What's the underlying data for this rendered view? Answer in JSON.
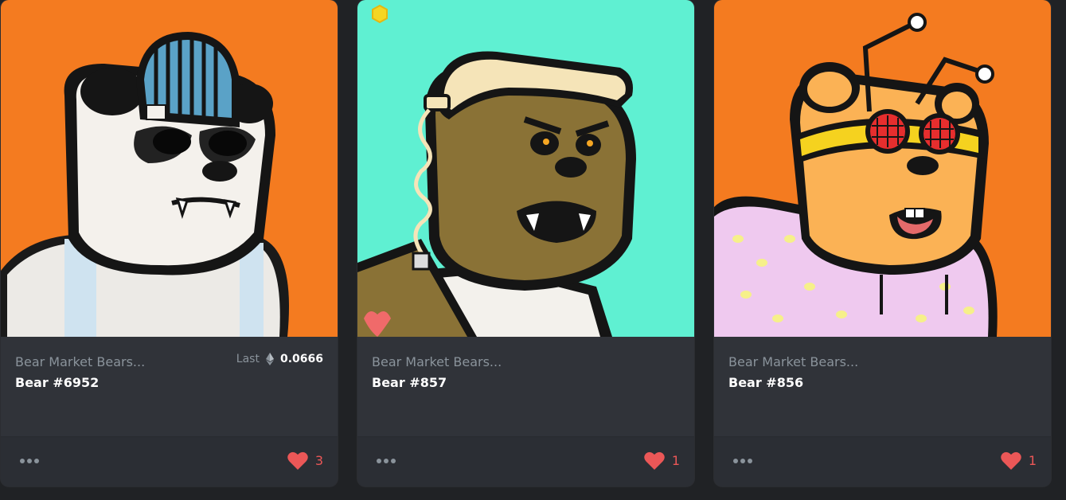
{
  "colors": {
    "page_bg": "#202225",
    "card_bg": "#303339",
    "footer_bg": "#2b2e34",
    "muted_text": "#8a939b",
    "heart": "#eb5757",
    "orange_bg": "#f47b20",
    "teal_bg": "#5ff0d2"
  },
  "cards": [
    {
      "collection": "Bear Market Bears...",
      "name": "Bear #6952",
      "last_label": "Last",
      "last_currency_icon": "ethereum-icon",
      "last_price": "0.0666",
      "more_icon": "more-dots-icon",
      "like_icon": "heart-icon",
      "likes": "3",
      "art": "panda bear with striped beanie and sunglasses on orange background"
    },
    {
      "collection": "Bear Market Bears...",
      "name": "Bear #857",
      "more_icon": "more-dots-icon",
      "like_icon": "heart-icon",
      "likes": "1",
      "art": "brown bear wearing a telephone receiver on teal background"
    },
    {
      "collection": "Bear Market Bears...",
      "name": "Bear #856",
      "more_icon": "more-dots-icon",
      "like_icon": "heart-icon",
      "likes": "1",
      "art": "orange bear with bug-eye antenna headband in pink hoodie on orange background"
    }
  ]
}
